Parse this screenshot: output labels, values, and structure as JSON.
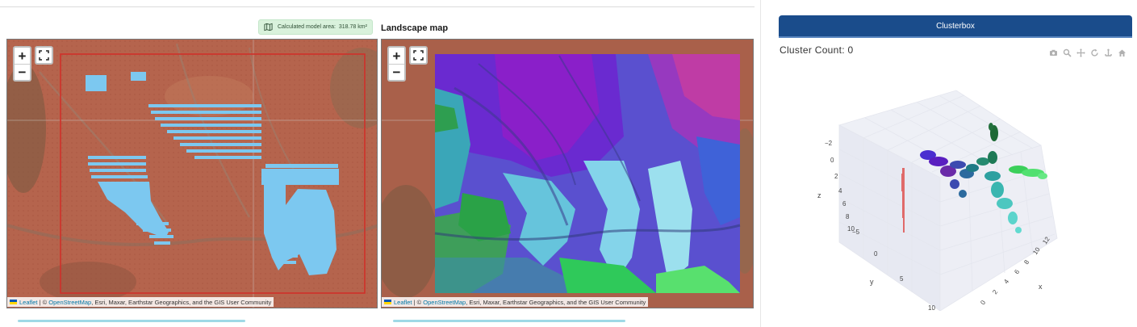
{
  "area_badge": {
    "label": "Calculated model area:",
    "value": "318.78 km²",
    "icon": "map-icon"
  },
  "landscape_map": {
    "title": "Landscape map"
  },
  "map_controls": {
    "zoom_in": "+",
    "zoom_out": "−",
    "fullscreen_icon": "fullscreen-icon"
  },
  "attribution": {
    "leaflet": "Leaflet",
    "separator": " | © ",
    "osm": "OpenStreetMap",
    "rest": ", Esri, Maxar, Earthstar Geographics, and the GIS User Community"
  },
  "clusterbox": {
    "header": "Clusterbox",
    "count_label": "Cluster Count: 0",
    "modebar_icons": [
      "camera-icon",
      "zoom-icon",
      "pan-icon",
      "orbit-icon",
      "turntable-icon",
      "home-icon"
    ]
  },
  "plot3d_axes": {
    "z": {
      "title": "z",
      "ticks": [
        "−2",
        "0",
        "2",
        "4",
        "6",
        "8",
        "10"
      ]
    },
    "y": {
      "title": "y",
      "ticks": [
        "−5",
        "0",
        "5",
        "10"
      ]
    },
    "x": {
      "title": "x",
      "ticks": [
        "12",
        "10",
        "8",
        "6",
        "4",
        "2",
        "0"
      ]
    }
  },
  "colors": {
    "header_blue": "#1a4c8b",
    "badge_green": "#d9f2dc",
    "selection_blue": "#7cc8f0",
    "boundary_red": "#d0302a",
    "link_blue": "#0078a8"
  }
}
